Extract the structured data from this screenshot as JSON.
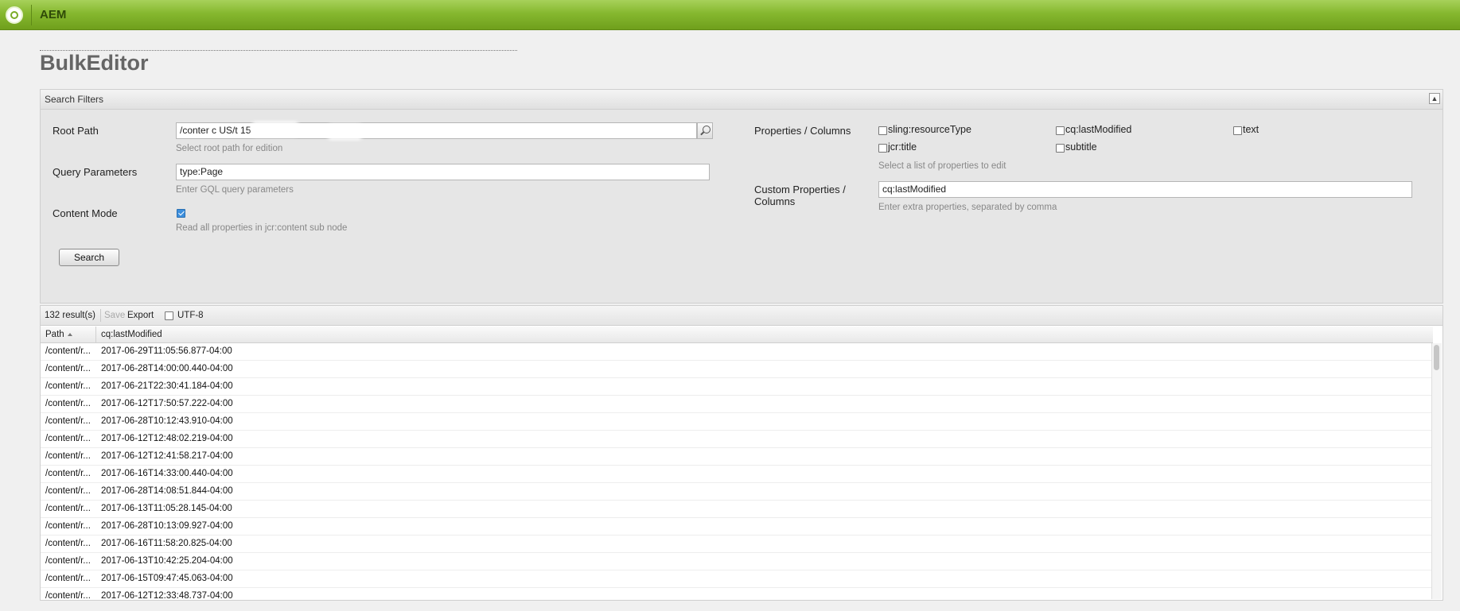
{
  "app": {
    "brand": "AEM",
    "page_title": "BulkEditor"
  },
  "search_filters": {
    "title": "Search Filters",
    "root_path": {
      "label": "Root Path",
      "value": "/conter        c  US/t          15",
      "hint": "Select root path for edition"
    },
    "query_params": {
      "label": "Query Parameters",
      "value": "type:Page",
      "hint": "Enter GQL query parameters"
    },
    "content_mode": {
      "label": "Content Mode",
      "checked": true,
      "hint": "Read all properties in jcr:content sub node"
    },
    "search_button": "Search",
    "properties": {
      "label": "Properties / Columns",
      "options": [
        {
          "label": "sling:resourceType",
          "checked": false
        },
        {
          "label": "cq:lastModified",
          "checked": false
        },
        {
          "label": "text",
          "checked": false
        },
        {
          "label": "jcr:title",
          "checked": false
        },
        {
          "label": "subtitle",
          "checked": false
        }
      ],
      "hint": "Select a list of properties to edit"
    },
    "custom_properties": {
      "label_line1": "Custom Properties /",
      "label_line2": "Columns",
      "value": "cq:lastModified",
      "hint": "Enter extra properties, separated by comma"
    }
  },
  "results": {
    "count_text": "132 result(s)",
    "save_label": "Save",
    "export_label": "Export",
    "utf8_label": "UTF-8",
    "columns": [
      "Path",
      "cq:lastModified"
    ],
    "rows": [
      {
        "path": "/content/r...",
        "modified": "2017-06-29T11:05:56.877-04:00"
      },
      {
        "path": "/content/r...",
        "modified": "2017-06-28T14:00:00.440-04:00"
      },
      {
        "path": "/content/r...",
        "modified": "2017-06-21T22:30:41.184-04:00"
      },
      {
        "path": "/content/r...",
        "modified": "2017-06-12T17:50:57.222-04:00"
      },
      {
        "path": "/content/r...",
        "modified": "2017-06-28T10:12:43.910-04:00"
      },
      {
        "path": "/content/r...",
        "modified": "2017-06-12T12:48:02.219-04:00"
      },
      {
        "path": "/content/r...",
        "modified": "2017-06-12T12:41:58.217-04:00"
      },
      {
        "path": "/content/r...",
        "modified": "2017-06-16T14:33:00.440-04:00"
      },
      {
        "path": "/content/r...",
        "modified": "2017-06-28T14:08:51.844-04:00"
      },
      {
        "path": "/content/r...",
        "modified": "2017-06-13T11:05:28.145-04:00"
      },
      {
        "path": "/content/r...",
        "modified": "2017-06-28T10:13:09.927-04:00"
      },
      {
        "path": "/content/r...",
        "modified": "2017-06-16T11:58:20.825-04:00"
      },
      {
        "path": "/content/r...",
        "modified": "2017-06-13T10:42:25.204-04:00"
      },
      {
        "path": "/content/r...",
        "modified": "2017-06-15T09:47:45.063-04:00"
      },
      {
        "path": "/content/r...",
        "modified": "2017-06-12T12:33:48.737-04:00"
      }
    ]
  }
}
